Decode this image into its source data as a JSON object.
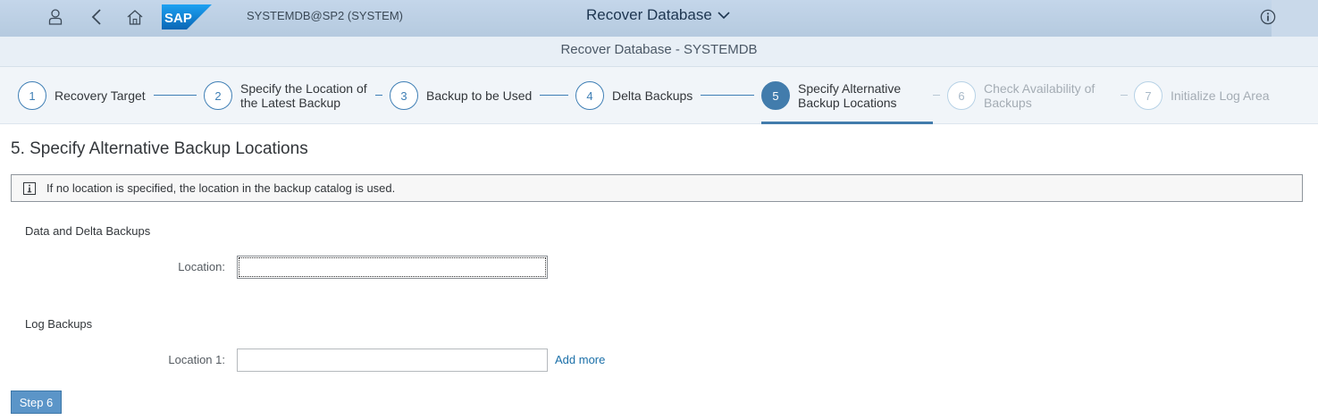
{
  "shell": {
    "system_name": "SYSTEMDB@SP2 (SYSTEM)",
    "app_title": "Recover Database",
    "logo_text": "SAP",
    "icons": [
      "user-icon",
      "back-icon",
      "home-icon",
      "chevron-down-icon",
      "help-icon"
    ]
  },
  "subheader": {
    "title": "Recover Database - SYSTEMDB"
  },
  "wizard": {
    "steps": [
      {
        "number": "1",
        "label": "Recovery Target",
        "state": "completed"
      },
      {
        "number": "2",
        "label": "Specify the Location of the Latest Backup",
        "state": "completed"
      },
      {
        "number": "3",
        "label": "Backup to be Used",
        "state": "completed"
      },
      {
        "number": "4",
        "label": "Delta Backups",
        "state": "completed"
      },
      {
        "number": "5",
        "label": "Specify Alternative Backup Locations",
        "state": "active"
      },
      {
        "number": "6",
        "label": "Check Availability of Backups",
        "state": "disabled"
      },
      {
        "number": "7",
        "label": "Initialize Log Area",
        "state": "disabled"
      }
    ]
  },
  "page": {
    "title": "5. Specify Alternative Backup Locations",
    "info_message": "If no location is specified, the location in the backup catalog is used.",
    "data_section": {
      "heading": "Data and Delta Backups",
      "location_label": "Location:",
      "location_value": ""
    },
    "log_section": {
      "heading": "Log Backups",
      "location_label": "Location 1:",
      "location_value": "",
      "add_more": "Add more"
    },
    "next_button": "Step 6"
  },
  "colors": {
    "shell_bg": "#b5cadf",
    "accent": "#427cac",
    "link": "#1a6fa8",
    "button": "#5b95c8"
  }
}
